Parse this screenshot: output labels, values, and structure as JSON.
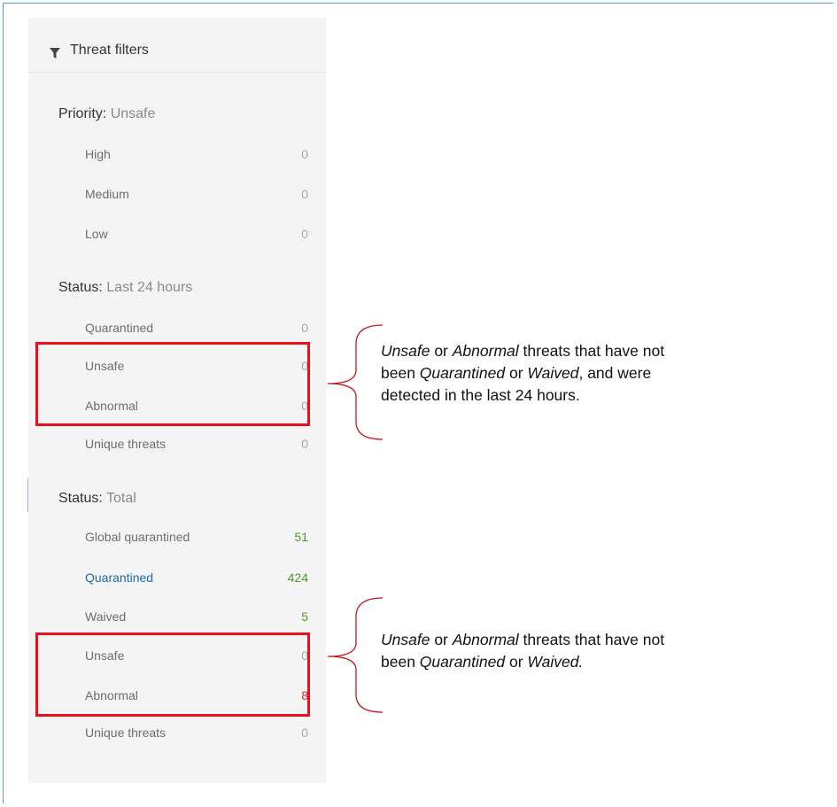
{
  "panel": {
    "header_title": "Threat filters",
    "header_icon": "filter-icon"
  },
  "sections": {
    "priority": {
      "label": "Priority:",
      "value": "Unsafe",
      "rows": [
        {
          "label": "High",
          "count": "0"
        },
        {
          "label": "Medium",
          "count": "0"
        },
        {
          "label": "Low",
          "count": "0"
        }
      ]
    },
    "status_24h": {
      "label": "Status:",
      "value": "Last 24 hours",
      "rows": [
        {
          "label": "Quarantined",
          "count": "0"
        },
        {
          "label": "Unsafe",
          "count": "0"
        },
        {
          "label": "Abnormal",
          "count": "0"
        },
        {
          "label": "Unique threats",
          "count": "0"
        }
      ]
    },
    "status_total": {
      "label": "Status:",
      "value": "Total",
      "rows": [
        {
          "label": "Global quarantined",
          "count": "51"
        },
        {
          "label": "Quarantined",
          "count": "424"
        },
        {
          "label": "Waived",
          "count": "5"
        },
        {
          "label": "Unsafe",
          "count": "0"
        },
        {
          "label": "Abnormal",
          "count": "8"
        },
        {
          "label": "Unique threats",
          "count": "0"
        }
      ]
    }
  },
  "annotations": {
    "note1": {
      "l1_a": "Unsafe",
      "l1_b": " or ",
      "l1_c": "Abnormal",
      "l1_d": " threats that have not",
      "l2_a": "been ",
      "l2_b": "Quarantined",
      "l2_c": " or ",
      "l2_d": "Waived",
      "l2_e": ", and were",
      "l3": "detected in the last 24 hours."
    },
    "note2": {
      "l1_a": "Unsafe",
      "l1_b": " or ",
      "l1_c": "Abnormal",
      "l1_d": " threats that have not",
      "l2_a": "been ",
      "l2_b": "Quarantined",
      "l2_c": " or ",
      "l2_d": "Waived."
    }
  },
  "colors": {
    "highlight": "#e8101a",
    "link_blue": "#1b6aa8",
    "count_green": "#4e9a2a",
    "count_red": "#d12d2d",
    "frame_blue": "#5b9bd5"
  }
}
